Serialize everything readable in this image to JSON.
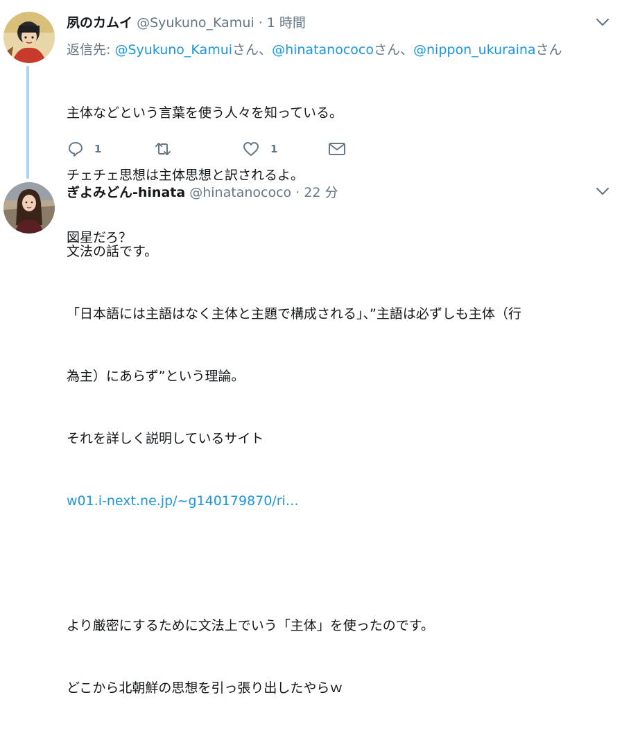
{
  "tweet1": {
    "name": "夙のカムイ",
    "handle": "@Syukuno_Kamui",
    "dot": "·",
    "time": "1 時間",
    "reply_prefix": "返信先: ",
    "mentions": [
      "@Syukuno_Kamui",
      "@hinatanococo",
      "@nippon_ukuraina"
    ],
    "san": "さん",
    "separator": "、",
    "text_lines": [
      "主体などという言葉を使う人々を知っている。",
      "チェチェ思想は主体思想と訳されるよ。",
      "図星だろ？"
    ],
    "actions": {
      "reply_count": "1",
      "retweet_count": "",
      "like_count": "1"
    },
    "icons": [
      "reply-icon",
      "retweet-icon",
      "like-icon",
      "message-icon",
      "chevron-down-icon"
    ]
  },
  "tweet2": {
    "name": "ぎよみどん-hinata",
    "handle": "@hinatanococo",
    "dot": "·",
    "time": "22 分",
    "text_lines": [
      "文法の話です。",
      "「日本語には主語はなく主体と主題で構成される」、”主語は必ずしも主体（行",
      "為主）にあらず”という理論。",
      "それを詳しく説明しているサイト"
    ],
    "link": "w01.i-next.ne.jp/~g140179870/ri…",
    "text_lines_after": [
      "",
      "より厳密にするために文法上でいう「主体」を使ったのです。",
      "どこから北朝鮮の思想を引っ張り出したやらｗ"
    ]
  },
  "colors": {
    "accent": "#1b95e0",
    "muted": "#657786",
    "thread_line": "#a8d4f5",
    "text": "#14171a"
  }
}
